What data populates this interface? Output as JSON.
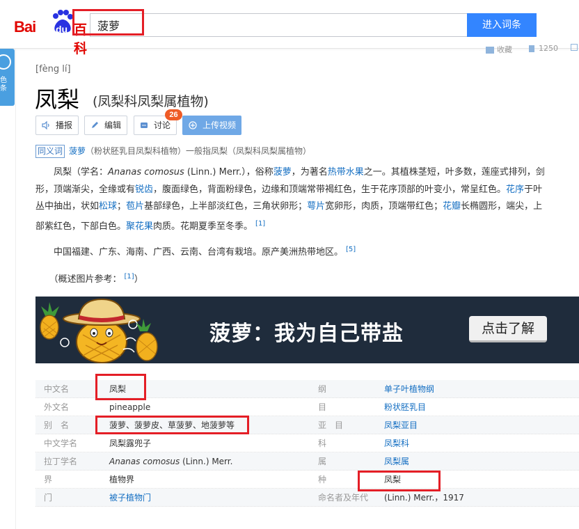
{
  "header": {
    "logo_bai": "Bai",
    "logo_du": "du",
    "logo_baike": "百科",
    "search_value": "菠萝",
    "search_button": "进入词条"
  },
  "sidebar_tab": {
    "text": "色条"
  },
  "toolbar_right": {
    "collect_label": "收藏",
    "share_count": "1250"
  },
  "entry": {
    "pinyin": "[fèng lí]",
    "title": "凤梨",
    "subtitle": "(凤梨科凤梨属植物)",
    "actions": {
      "play": "播报",
      "edit": "编辑",
      "discuss": "讨论",
      "discuss_count": "26",
      "upload_video": "上传视频"
    },
    "synonym": {
      "tag": "同义词",
      "term": "菠萝",
      "desc": "（粉状胚乳目凤梨科植物）一般指凤梨（凤梨科凤梨属植物）"
    }
  },
  "summary": {
    "p1_line1_a": "凤梨（学名：",
    "p1_line1_latin": "Ananas comosus",
    "p1_line1_b": " (Linn.) Merr.），俗称",
    "p1_line1_link1": "菠萝",
    "p1_line1_c": "，为著名",
    "p1_line1_link2": "热带水果",
    "p1_line1_d": "之一。其植株茎短，叶多数，莲座式排列，剑",
    "p1_line2_a": "形，顶端渐尖，全缘或有",
    "p1_line2_link1": "锐齿",
    "p1_line2_b": "，腹面绿色，背面粉绿色，边缘和顶端常带褐红色，生于花序顶部的叶变小，常呈红色。",
    "p1_line2_link2": "花序",
    "p1_line2_c": "于叶",
    "p1_line3_a": "丛中抽出，状如",
    "p1_line3_link1": "松球",
    "p1_line3_b": "；",
    "p1_line3_link2": "苞片",
    "p1_line3_c": "基部绿色，上半部淡红色，三角状卵形；",
    "p1_line3_link3": "萼片",
    "p1_line3_d": "宽卵形，肉质，顶端带红色；",
    "p1_line3_link4": "花瓣",
    "p1_line3_e": "长椭圆形，端尖，上",
    "p1_line4_a": "部紫红色，下部白色。",
    "p1_line4_link1": "聚花果",
    "p1_line4_b": "肉质。花期夏季至冬季。",
    "p1_ref": "[1]",
    "p2": "中国福建、广东、海南、广西、云南、台湾有栽培。原产美洲热带地区。",
    "p2_ref": "[5]",
    "p3_a": "（概述图片参考：",
    "p3_ref": "[1]",
    "p3_b": "）"
  },
  "banner": {
    "slogan": "菠萝：我为自己带盐",
    "cta": "点击了解"
  },
  "basic_info": [
    {
      "k1": "中文名",
      "v1": "凤梨",
      "k2": "纲",
      "v2": "单子叶植物纲",
      "v2_link": true
    },
    {
      "k1": "外文名",
      "v1": "pineapple",
      "k2": "目",
      "v2": "粉状胚乳目",
      "v2_link": true
    },
    {
      "k1": "别　名",
      "v1": "菠萝、菠萝皮、草菠萝、地菠萝等",
      "k2": "亚　目",
      "v2": "凤梨亚目",
      "v2_link": true
    },
    {
      "k1": "中文学名",
      "v1": "凤梨露兜子",
      "k2": "科",
      "v2": "凤梨科",
      "v2_link": true
    },
    {
      "k1": "拉丁学名",
      "v1_latin": "Ananas comosus",
      "v1_rest": " (Linn.) Merr.",
      "k2": "属",
      "v2": "凤梨属",
      "v2_link": true
    },
    {
      "k1": "界",
      "v1": "植物界",
      "k2": "种",
      "v2": "凤梨",
      "v2_link": false
    },
    {
      "k1": "门",
      "v1": "被子植物门",
      "v1_link": true,
      "k2": "命名者及年代",
      "v2": "(Linn.) Merr.，1917",
      "v2_link": false
    }
  ],
  "colors": {
    "accent": "#3385ff",
    "link": "#136ec2",
    "highlight_box": "#e41e26",
    "brand_red": "#e10601"
  }
}
